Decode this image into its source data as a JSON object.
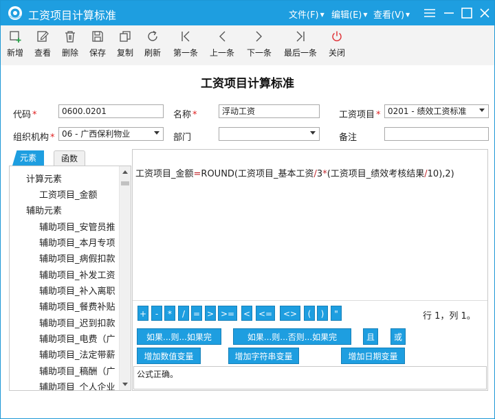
{
  "window": {
    "title": "工资项目计算标准",
    "colors": {
      "accent": "#1e9ee0",
      "required": "#e02020",
      "operator": "#c0282d"
    }
  },
  "menu": [
    {
      "label": "文件(F)",
      "icon": "caret-down-icon"
    },
    {
      "label": "编辑(E)",
      "icon": "caret-down-icon"
    },
    {
      "label": "查看(V)",
      "icon": "caret-down-icon"
    }
  ],
  "toolbar": [
    {
      "label": "新增",
      "icon": "add-icon"
    },
    {
      "label": "查看",
      "icon": "edit-icon"
    },
    {
      "label": "删除",
      "icon": "trash-icon"
    },
    {
      "label": "保存",
      "icon": "save-icon"
    },
    {
      "label": "复制",
      "icon": "copy-icon"
    },
    {
      "label": "刷新",
      "icon": "refresh-icon"
    },
    {
      "label": "第一条",
      "icon": "first-record-icon"
    },
    {
      "label": "上一条",
      "icon": "previous-record-icon"
    },
    {
      "label": "下一条",
      "icon": "next-record-icon"
    },
    {
      "label": "最后一条",
      "icon": "last-record-icon"
    },
    {
      "label": "关闭",
      "icon": "power-icon"
    }
  ],
  "form": {
    "title": "工资项目计算标准",
    "code": {
      "label": "代码",
      "value": "0600.0201"
    },
    "name": {
      "label": "名称",
      "value": "浮动工资"
    },
    "salary_item": {
      "label": "工资项目",
      "value": "0201 - 绩效工资标准"
    },
    "org": {
      "label": "组织机构",
      "value": "06 - 广西保利物业"
    },
    "dept": {
      "label": "部门",
      "value": ""
    },
    "remark": {
      "label": "备注",
      "value": ""
    }
  },
  "left_panel": {
    "tabs": [
      "元素",
      "函数"
    ],
    "tree": [
      {
        "label": "计算元素",
        "level": 1
      },
      {
        "label": "工资项目_金额",
        "level": 2
      },
      {
        "label": "辅助元素",
        "level": 1
      },
      {
        "label": "辅助项目_安管员推",
        "level": 2
      },
      {
        "label": "辅助项目_本月专项",
        "level": 2
      },
      {
        "label": "辅助项目_病假扣款",
        "level": 2
      },
      {
        "label": "辅助项目_补发工资",
        "level": 2
      },
      {
        "label": "辅助项目_补入离职",
        "level": 2
      },
      {
        "label": "辅助项目_餐费补贴",
        "level": 2
      },
      {
        "label": "辅助项目_迟到扣款",
        "level": 2
      },
      {
        "label": "辅助项目_电费（广",
        "level": 2
      },
      {
        "label": "辅助项目_法定带薪",
        "level": 2
      },
      {
        "label": "辅助项目_稿酬（广",
        "level": 2
      },
      {
        "label": "辅助项目_个人企业",
        "level": 2
      }
    ]
  },
  "editor": {
    "formula_parts": [
      {
        "t": "工资项目_金额",
        "op": false
      },
      {
        "t": "=",
        "op": true
      },
      {
        "t": "ROUND(工资项目_基本工资",
        "op": false
      },
      {
        "t": "/",
        "op": true
      },
      {
        "t": "3",
        "op": false
      },
      {
        "t": "*",
        "op": true
      },
      {
        "t": "(工资项目_绩效考核结果",
        "op": false
      },
      {
        "t": "/",
        "op": true
      },
      {
        "t": "10),2)",
        "op": false
      }
    ],
    "operators": [
      "+",
      "-",
      "*",
      "/",
      "=",
      ">",
      ">=",
      "<",
      "<=",
      "<>",
      "(",
      ")",
      "\""
    ],
    "cursor_position": "行 1，列 1。",
    "buttons_row1": [
      "如果...则...如果完",
      "如果...则...否则...如果完",
      "且",
      "或"
    ],
    "buttons_row2": [
      "增加数值变量",
      "增加字符串变量",
      "增加日期变量"
    ],
    "status": "公式正确。"
  }
}
